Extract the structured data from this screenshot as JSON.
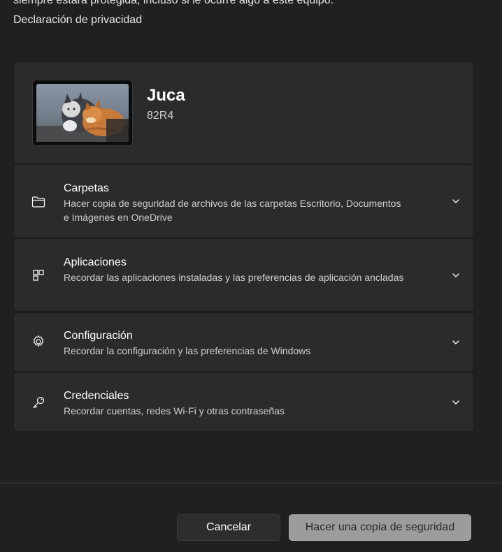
{
  "intro": {
    "text": "siempre estará protegida, incluso si le ocurre algo a este equipo.",
    "privacy_link": "Declaración de privacidad"
  },
  "device": {
    "name": "Juca",
    "model": "82R4"
  },
  "sections": [
    {
      "title": "Carpetas",
      "description": "Hacer copia de seguridad de archivos de las carpetas Escritorio, Documentos e Imágenes en OneDrive",
      "icon": "folder-icon"
    },
    {
      "title": "Aplicaciones",
      "description": "Recordar las aplicaciones instaladas y las preferencias de aplicación ancladas",
      "icon": "apps-icon"
    },
    {
      "title": "Configuración",
      "description": "Recordar la configuración y las preferencias de Windows",
      "icon": "gear-icon"
    },
    {
      "title": "Credenciales",
      "description": "Recordar cuentas, redes Wi-Fi y otras contraseñas",
      "icon": "key-icon"
    }
  ],
  "buttons": {
    "cancel": "Cancelar",
    "backup": "Hacer una copia de seguridad"
  },
  "colors": {
    "background": "#202020",
    "card": "#2b2b2b",
    "primary_button": "#9c9c9c"
  }
}
